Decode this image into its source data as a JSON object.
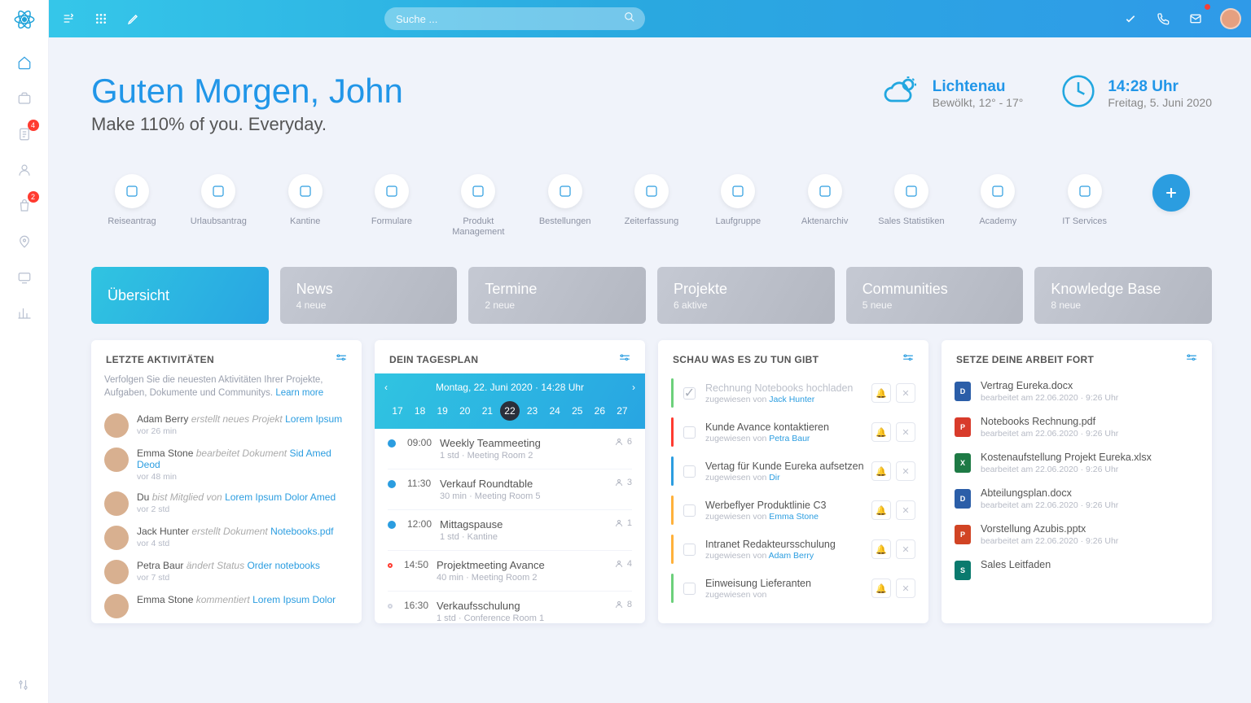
{
  "search": {
    "placeholder": "Suche ..."
  },
  "rail": {
    "badges": {
      "docs": "4",
      "shop": "2"
    }
  },
  "greeting": {
    "title": "Guten Morgen, John",
    "subtitle": "Make 110% of you. Everyday."
  },
  "weather": {
    "city": "Lichtenau",
    "summary": "Bewölkt, 12° - 17°"
  },
  "clock": {
    "time": "14:28 Uhr",
    "date": "Freitag, 5. Juni 2020"
  },
  "shortcuts": [
    "Reiseantrag",
    "Urlaubsantrag",
    "Kantine",
    "Formulare",
    "Produkt Management",
    "Bestellungen",
    "Zeiterfassung",
    "Laufgruppe",
    "Aktenarchiv",
    "Sales Statistiken",
    "Academy",
    "IT Services"
  ],
  "dashtabs": [
    {
      "title": "Übersicht",
      "subtitle": "",
      "active": true
    },
    {
      "title": "News",
      "subtitle": "4 neue"
    },
    {
      "title": "Termine",
      "subtitle": "2 neue"
    },
    {
      "title": "Projekte",
      "subtitle": "6 aktive"
    },
    {
      "title": "Communities",
      "subtitle": "5 neue"
    },
    {
      "title": "Knowledge Base",
      "subtitle": "8 neue"
    }
  ],
  "cards": {
    "activities": {
      "title": "LETZTE AKTIVITÄTEN",
      "hint": "Verfolgen Sie die neuesten Aktivitäten Ihrer Projekte, Aufgaben, Dokumente und Communitys.",
      "learn": "Learn more",
      "items": [
        {
          "name": "Adam Berry",
          "action": "erstellt neues Projekt",
          "link": "Lorem Ipsum",
          "meta": "vor 26 min"
        },
        {
          "name": "Emma Stone",
          "action": "bearbeitet Dokument",
          "link": "Sid Amed Deod",
          "meta": "vor 48 min"
        },
        {
          "name": "Du",
          "action": "bist Mitglied von",
          "link": "Lorem Ipsum Dolor Amed",
          "meta": "vor 2 std"
        },
        {
          "name": "Jack Hunter",
          "action": "erstellt Dokument",
          "link": "Notebooks.pdf",
          "meta": "vor 4 std"
        },
        {
          "name": "Petra Baur",
          "action": "ändert Status",
          "link": "Order notebooks",
          "meta": "vor 7 std"
        },
        {
          "name": "Emma Stone",
          "action": "kommentiert",
          "link": "Lorem Ipsum Dolor",
          "meta": ""
        }
      ]
    },
    "schedule": {
      "title": "DEIN TAGESPLAN",
      "dateLabel": "Montag, 22. Juni 2020 · 14:28 Uhr",
      "days": [
        "17",
        "18",
        "19",
        "20",
        "21",
        "22",
        "23",
        "24",
        "25",
        "26",
        "27"
      ],
      "current": "22",
      "events": [
        {
          "status": "done",
          "time": "09:00",
          "title": "Weekly Teammeeting",
          "sub": "1 std · Meeting Room 2",
          "att": "6"
        },
        {
          "status": "done",
          "time": "11:30",
          "title": "Verkauf Roundtable",
          "sub": "30 min · Meeting Room 5",
          "att": "3"
        },
        {
          "status": "done",
          "time": "12:00",
          "title": "Mittagspause",
          "sub": "1 std · Kantine",
          "att": "1"
        },
        {
          "status": "now",
          "time": "14:50",
          "title": "Projektmeeting Avance",
          "sub": "40 min · Meeting Room 2",
          "att": "4"
        },
        {
          "status": "upcoming",
          "time": "16:30",
          "title": "Verkaufsschulung",
          "sub": "1 std · Conference Room 1",
          "att": "8"
        }
      ]
    },
    "todo": {
      "title": "SCHAU WAS ES ZU TUN GIBT",
      "items": [
        {
          "color": "#6cd07b",
          "done": true,
          "title": "Rechnung Notebooks hochladen",
          "by": "Jack Hunter"
        },
        {
          "color": "#ff3b30",
          "done": false,
          "title": "Kunde Avance kontaktieren",
          "by": "Petra Baur"
        },
        {
          "color": "#2b9de0",
          "done": false,
          "title": "Vertag für Kunde Eureka aufsetzen",
          "by": "Dir"
        },
        {
          "color": "#ffb13b",
          "done": false,
          "title": "Werbeflyer Produktlinie C3",
          "by": "Emma Stone"
        },
        {
          "color": "#ffb13b",
          "done": false,
          "title": "Intranet Redakteursschulung",
          "by": "Adam Berry"
        },
        {
          "color": "#6cd07b",
          "done": false,
          "title": "Einweisung Lieferanten",
          "by": ""
        }
      ],
      "assignedPrefix": "zugewiesen von "
    },
    "docs": {
      "title": "SETZE DEINE ARBEIT FORT",
      "items": [
        {
          "icon": "docx",
          "title": "Vertrag Eureka.docx",
          "meta": "bearbeitet am 22.06.2020 · 9:26 Uhr"
        },
        {
          "icon": "pdf",
          "title": "Notebooks Rechnung.pdf",
          "meta": "bearbeitet am 22.06.2020 · 9:26 Uhr"
        },
        {
          "icon": "xlsx",
          "title": "Kostenaufstellung Projekt Eureka.xlsx",
          "meta": "bearbeitet am 22.06.2020 · 9:26 Uhr"
        },
        {
          "icon": "docx",
          "title": "Abteilungsplan.docx",
          "meta": "bearbeitet am 22.06.2020 · 9:26 Uhr"
        },
        {
          "icon": "pptx",
          "title": "Vorstellung Azubis.pptx",
          "meta": "bearbeitet am 22.06.2020 · 9:26 Uhr"
        },
        {
          "icon": "sp",
          "title": "Sales Leitfaden",
          "meta": ""
        }
      ]
    }
  }
}
